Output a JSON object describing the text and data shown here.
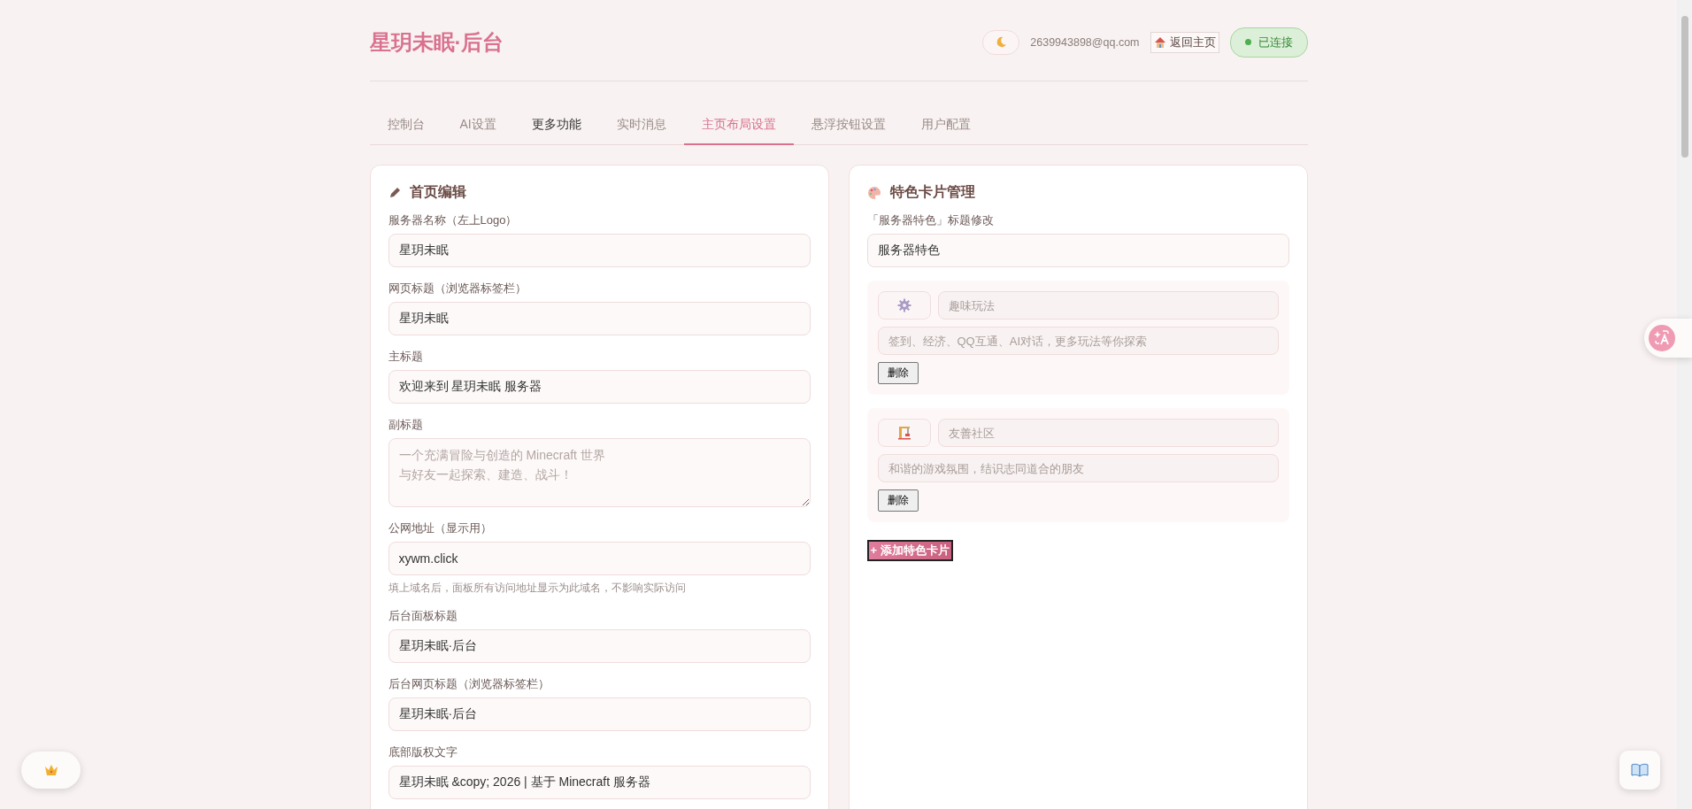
{
  "header": {
    "title": "星玥未眠·后台",
    "email": "2639943898@qq.com",
    "home_link": "返回主页",
    "status": "已连接",
    "connected": true,
    "dark_mode": false
  },
  "tabs": [
    {
      "label": "控制台",
      "selected": false,
      "hovered": false
    },
    {
      "label": "AI设置",
      "selected": false,
      "hovered": false
    },
    {
      "label": "更多功能",
      "selected": false,
      "hovered": true
    },
    {
      "label": "实时消息",
      "selected": false,
      "hovered": false
    },
    {
      "label": "主页布局设置",
      "selected": true,
      "hovered": false
    },
    {
      "label": "悬浮按钮设置",
      "selected": false,
      "hovered": false
    },
    {
      "label": "用户配置",
      "selected": false,
      "hovered": false
    }
  ],
  "home_edit": {
    "title": "首页编辑",
    "fields": [
      {
        "kind": "input",
        "label": "服务器名称（左上Logo）",
        "value": "星玥未眠"
      },
      {
        "kind": "input",
        "label": "网页标题（浏览器标签栏）",
        "value": "星玥未眠"
      },
      {
        "kind": "input",
        "label": "主标题",
        "value": "欢迎来到 星玥未眠 服务器"
      },
      {
        "kind": "textarea",
        "label": "副标题",
        "placeholder_lines": [
          "一个充满冒险与创造的 Minecraft 世界",
          "与好友一起探索、建造、战斗！"
        ]
      },
      {
        "kind": "input",
        "label": "公网地址（显示用）",
        "value": "xywm.click",
        "hint": "填上域名后，面板所有访问地址显示为此域名，不影响实际访问"
      },
      {
        "kind": "input",
        "label": "后台面板标题",
        "value": "星玥未眠·后台"
      },
      {
        "kind": "input",
        "label": "后台网页标题（浏览器标签栏）",
        "value": "星玥未眠·后台"
      },
      {
        "kind": "input",
        "label": "底部版权文字",
        "value": "星玥未眠 &copy; 2026 | 基于 Minecraft 服务器"
      }
    ]
  },
  "feature_cards": {
    "title": "特色卡片管理",
    "label": "「服务器特色」标题修改",
    "value": "服务器特色",
    "cards": [
      {
        "title_placeholder": "趣味玩法",
        "desc_placeholder": "签到、经济、QQ互通、AI对话，更多玩法等你探索",
        "delete_button": "删除"
      },
      {
        "title_placeholder": "友善社区",
        "desc_placeholder": "和谐的游戏氛围，结识志同道合的朋友",
        "delete_button": "删除"
      }
    ],
    "add_button": "+ 添加特色卡片"
  }
}
